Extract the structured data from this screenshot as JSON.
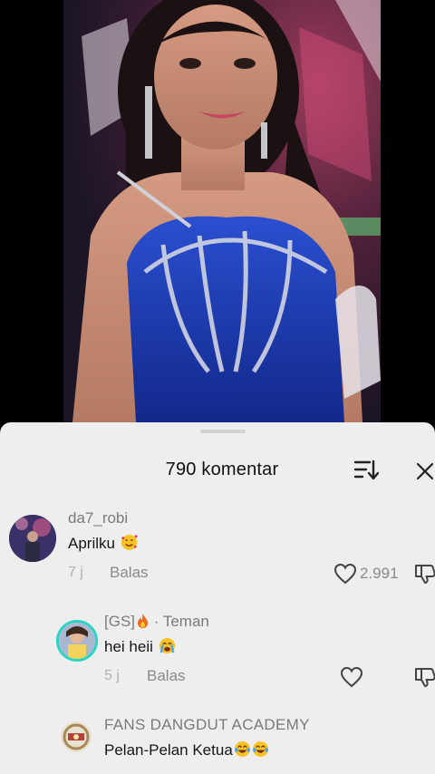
{
  "header": {
    "title": "790 komentar"
  },
  "comments": [
    {
      "username": "da7_robi",
      "text": "Aprilku",
      "time": "7 j",
      "reply_label": "Balas",
      "likes": "2.991",
      "emoji": "smiling-face-with-hearts-icon"
    },
    {
      "username": "[GS]",
      "username_suffix": "· Teman",
      "text": "hei heii",
      "time": "5 j",
      "reply_label": "Balas",
      "emoji": "loudly-crying-face-icon"
    },
    {
      "username": "FANS DANGDUT ACADEMY",
      "text": "Pelan-Pelan Ketua",
      "emoji": "tears-of-joy-icon"
    }
  ],
  "colors": {
    "sheet_background": "#eeeeee",
    "username": "#7a7a7a",
    "comment_text": "#161616",
    "meta": "#8a8a8a",
    "dress": "#1f3fae"
  }
}
